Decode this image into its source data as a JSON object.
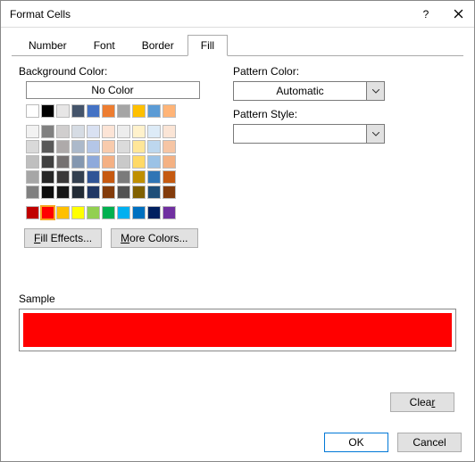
{
  "window": {
    "title": "Format Cells"
  },
  "tabs": {
    "number": "Number",
    "font": "Font",
    "border": "Border",
    "fill": "Fill",
    "active": "fill"
  },
  "labels": {
    "bg_color": "Background Color:",
    "no_color": "No Color",
    "pattern_color": "Pattern Color:",
    "pattern_style": "Pattern Style:",
    "sample": "Sample",
    "fill_effects_u": "F",
    "fill_effects_rest": "ill Effects...",
    "more_colors_u": "M",
    "more_colors_rest": "ore Colors...",
    "clear_u": "r",
    "clear_pre": "Clea",
    "ok": "OK",
    "cancel": "Cancel"
  },
  "pattern_color": {
    "value": "Automatic"
  },
  "pattern_style": {
    "value": ""
  },
  "selected_color": "#FF0000",
  "sample_color": "#FF0000",
  "palette": {
    "top_row": [
      "#FFFFFF",
      "#000000",
      "#E7E6E6",
      "#44546A",
      "#4472C4",
      "#ED7D31",
      "#A5A5A5",
      "#FFC000",
      "#5B9BD5",
      "#FFB477"
    ],
    "theme": [
      [
        "#F2F2F2",
        "#808080",
        "#D0CECE",
        "#D6DCE4",
        "#D9E1F2",
        "#FCE4D6",
        "#EDEDED",
        "#FFF2CC",
        "#DDEBF7",
        "#FBE5D6"
      ],
      [
        "#D9D9D9",
        "#595959",
        "#AEAAAA",
        "#ACB9CA",
        "#B4C6E7",
        "#F8CBAD",
        "#DBDBDB",
        "#FFE699",
        "#BDD7EE",
        "#F6C5A4"
      ],
      [
        "#BFBFBF",
        "#404040",
        "#757171",
        "#8497B0",
        "#8EA9DB",
        "#F4B084",
        "#C9C9C9",
        "#FFD966",
        "#9BC2E6",
        "#F4B183"
      ],
      [
        "#A6A6A6",
        "#262626",
        "#3A3838",
        "#333F4F",
        "#305496",
        "#C65911",
        "#7B7B7B",
        "#BF8F00",
        "#2F75B5",
        "#C55A11"
      ],
      [
        "#808080",
        "#0D0D0D",
        "#161616",
        "#222B35",
        "#203764",
        "#833C0C",
        "#525252",
        "#806000",
        "#1F4E78",
        "#833C0C"
      ]
    ],
    "standard": [
      "#C00000",
      "#FF0000",
      "#FFC000",
      "#FFFF00",
      "#92D050",
      "#00B050",
      "#00B0F0",
      "#0070C0",
      "#002060",
      "#7030A0"
    ]
  }
}
